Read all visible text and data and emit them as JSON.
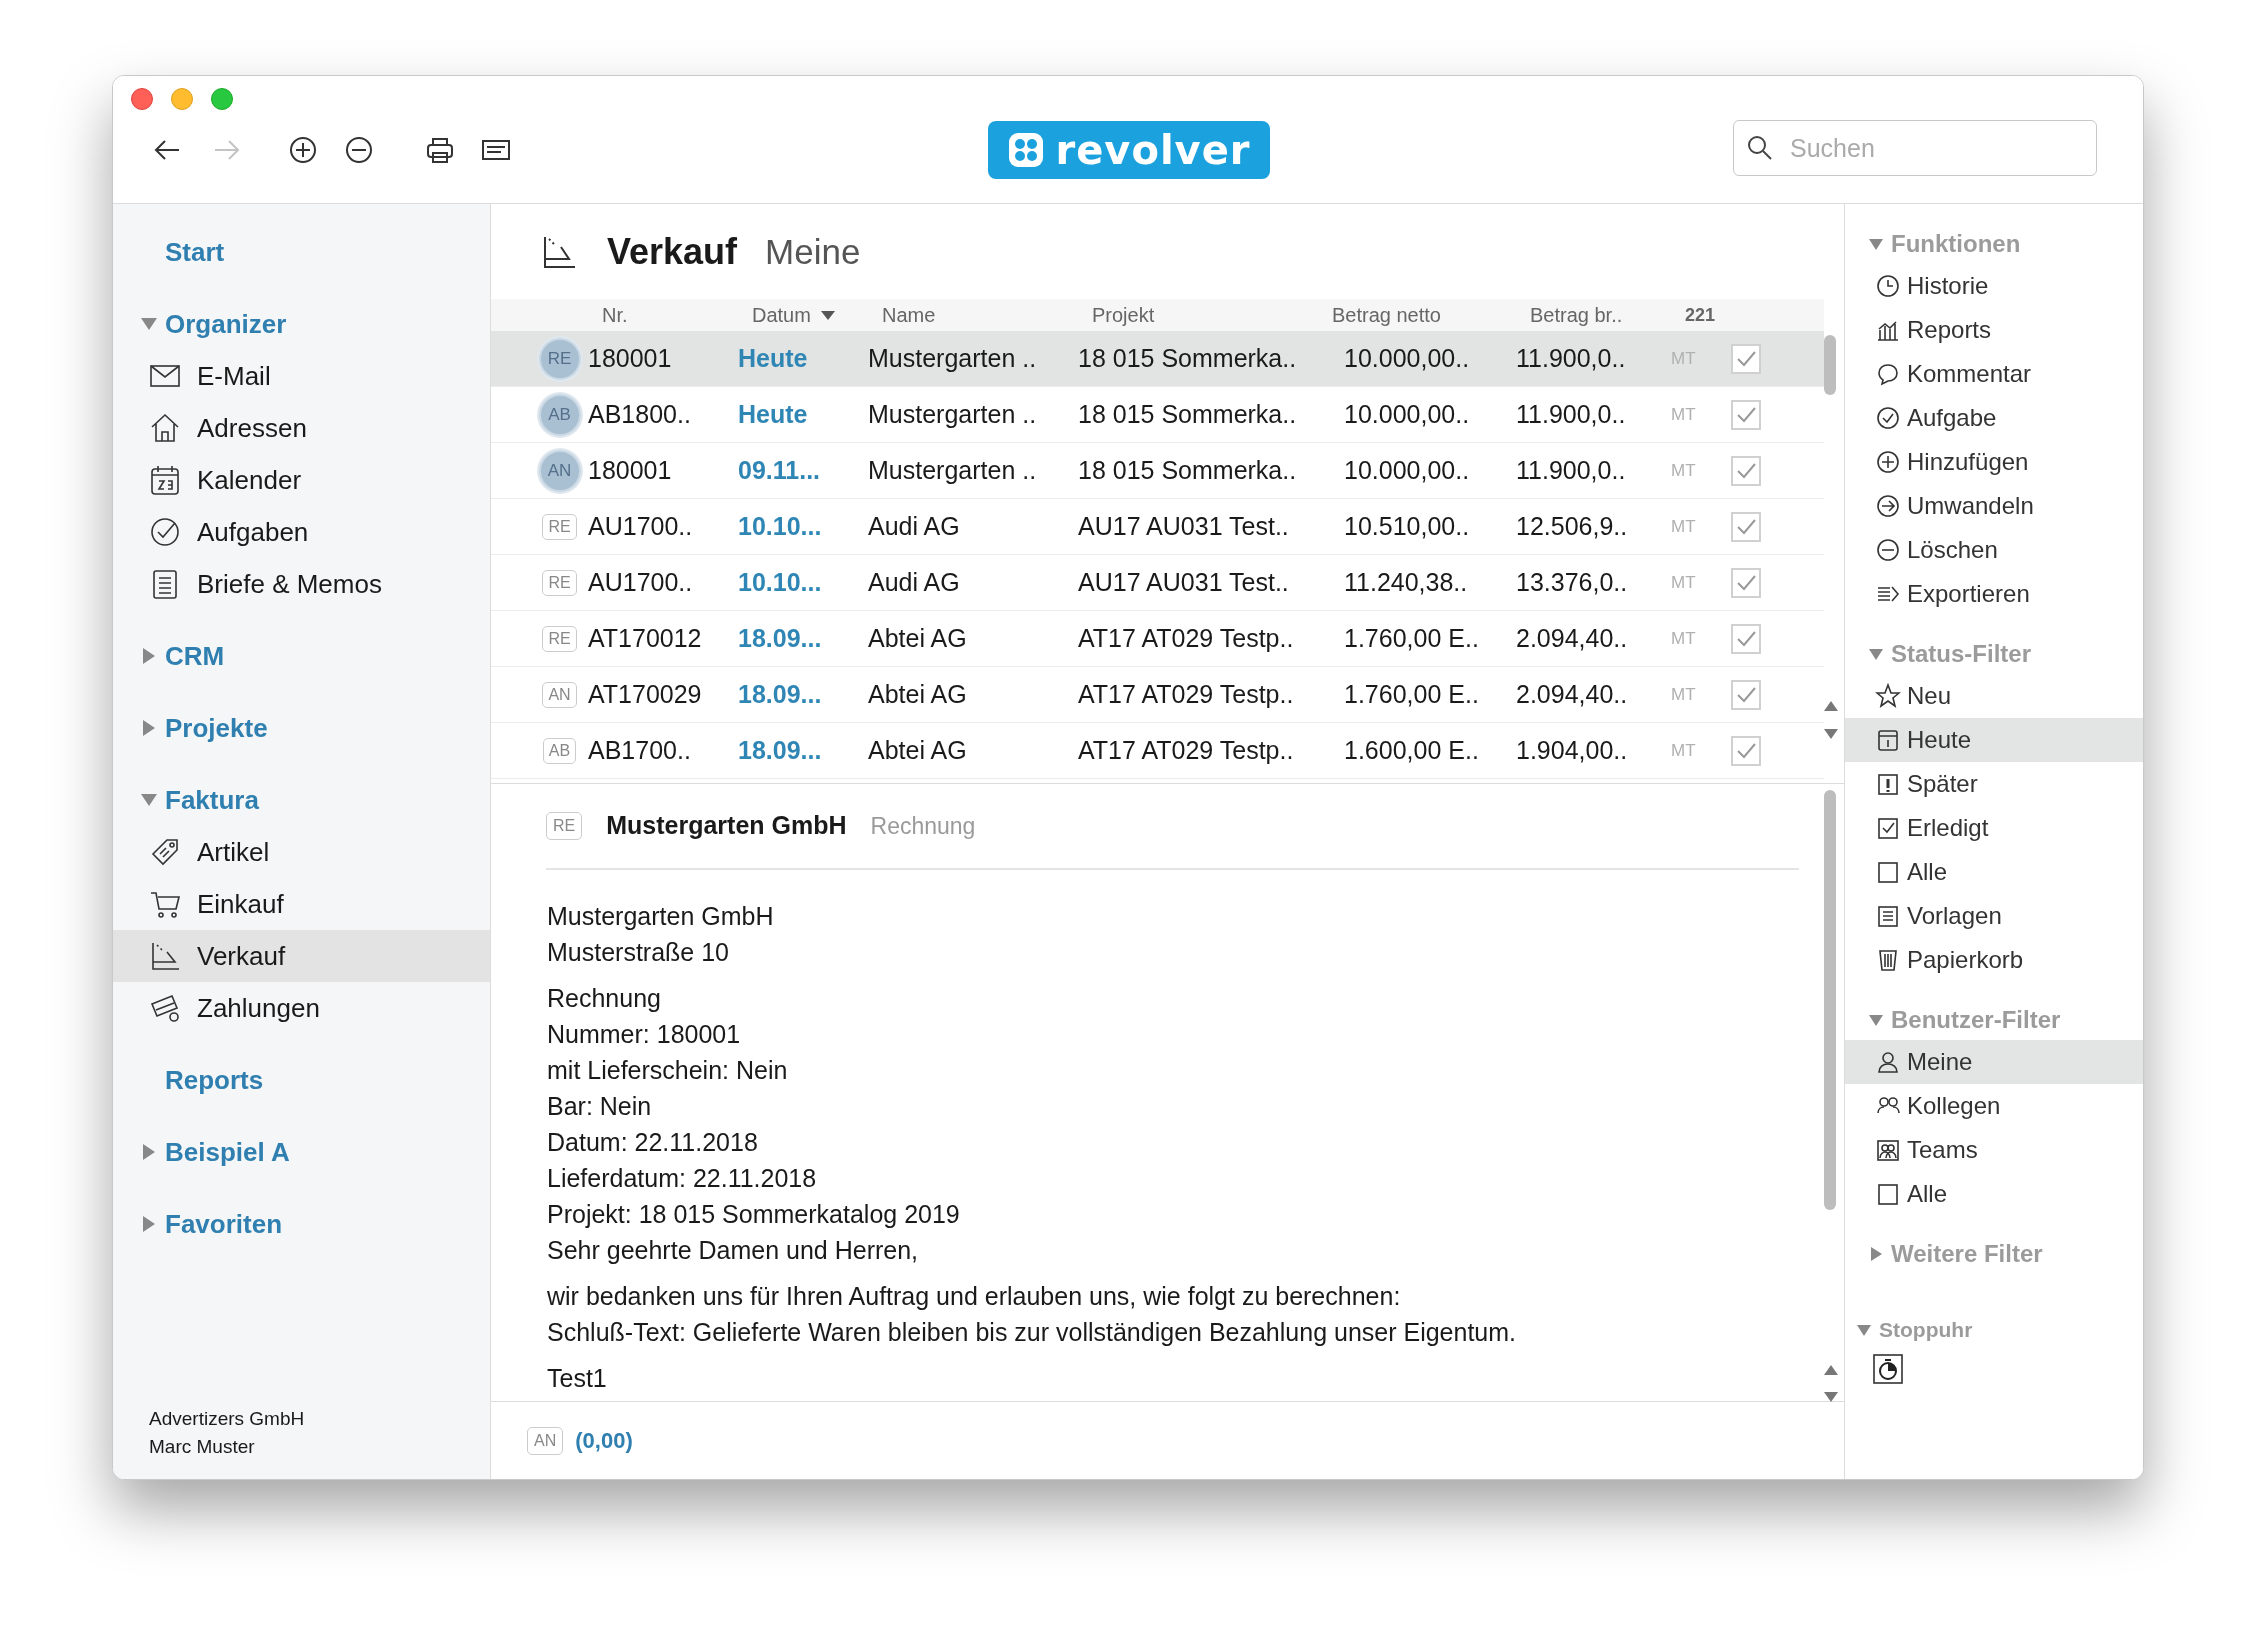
{
  "toolbar": {
    "buttons": [
      {
        "disabled": false
      },
      {
        "disabled": true
      },
      {
        "disabled": false
      },
      {
        "disabled": false
      },
      {
        "disabled": false
      },
      {
        "disabled": false
      }
    ],
    "logo": "revolver",
    "search": {
      "placeholder": "Suchen"
    }
  },
  "sidebar": {
    "sections": [
      {
        "kind": "link",
        "label": "Start"
      },
      {
        "kind": "group",
        "label": "Organizer",
        "expanded": true,
        "items": [
          {
            "label": "E-Mail",
            "selected": false
          },
          {
            "label": "Adressen",
            "selected": false
          },
          {
            "label": "Kalender",
            "selected": false
          },
          {
            "label": "Aufgaben",
            "selected": false
          },
          {
            "label": "Briefe & Memos",
            "selected": false
          }
        ]
      },
      {
        "kind": "group",
        "label": "CRM",
        "expanded": false
      },
      {
        "kind": "group",
        "label": "Projekte",
        "expanded": false
      },
      {
        "kind": "group",
        "label": "Faktura",
        "expanded": true,
        "items": [
          {
            "label": "Artikel",
            "selected": false
          },
          {
            "label": "Einkauf",
            "selected": false
          },
          {
            "label": "Verkauf",
            "selected": true
          },
          {
            "label": "Zahlungen",
            "selected": false
          }
        ]
      },
      {
        "kind": "link",
        "label": "Reports"
      },
      {
        "kind": "group",
        "label": "Beispiel A",
        "expanded": false
      },
      {
        "kind": "group",
        "label": "Favoriten",
        "expanded": false
      }
    ],
    "footer": [
      "Advertizers GmbH",
      "Marc Muster"
    ]
  },
  "main": {
    "title": "Verkauf",
    "subtitle": "Meine",
    "table": {
      "columns": [
        {
          "label": "Nr.",
          "sorted": false
        },
        {
          "label": "Datum",
          "sorted": true
        },
        {
          "label": "Name",
          "sorted": false
        },
        {
          "label": "Projekt",
          "sorted": false
        },
        {
          "label": "Betrag netto",
          "sorted": false
        },
        {
          "label": "Betrag br..",
          "sorted": false
        },
        {
          "label": "221",
          "sorted": false
        }
      ],
      "rows": [
        {
          "badge": "RE",
          "flagged": true,
          "nr": "180001",
          "datum": "Heute",
          "name": "Mustergarten ..",
          "projekt": "18 015 Sommerka..",
          "netto": "10.000,00..",
          "brutto": "11.900,0..",
          "currency": "MT",
          "checked": true,
          "selected": true
        },
        {
          "badge": "AB",
          "flagged": true,
          "nr": "AB1800..",
          "datum": "Heute",
          "name": "Mustergarten ..",
          "projekt": "18 015 Sommerka..",
          "netto": "10.000,00..",
          "brutto": "11.900,0..",
          "currency": "MT",
          "checked": true,
          "selected": false
        },
        {
          "badge": "AN",
          "flagged": true,
          "nr": "180001",
          "datum": "09.11...",
          "name": "Mustergarten ..",
          "projekt": "18 015 Sommerka..",
          "netto": "10.000,00..",
          "brutto": "11.900,0..",
          "currency": "MT",
          "checked": true,
          "selected": false
        },
        {
          "badge": "RE",
          "flagged": false,
          "nr": "AU1700..",
          "datum": "10.10...",
          "name": "Audi AG",
          "projekt": "AU17 AU031 Test..",
          "netto": "10.510,00..",
          "brutto": "12.506,9..",
          "currency": "MT",
          "checked": true,
          "selected": false
        },
        {
          "badge": "RE",
          "flagged": false,
          "nr": "AU1700..",
          "datum": "10.10...",
          "name": "Audi AG",
          "projekt": "AU17 AU031 Test..",
          "netto": "11.240,38..",
          "brutto": "13.376,0..",
          "currency": "MT",
          "checked": true,
          "selected": false
        },
        {
          "badge": "RE",
          "flagged": false,
          "nr": "AT170012",
          "datum": "18.09...",
          "name": "Abtei AG",
          "projekt": "AT17 AT029 Testp..",
          "netto": "1.760,00 E..",
          "brutto": "2.094,40..",
          "currency": "MT",
          "checked": true,
          "selected": false
        },
        {
          "badge": "AN",
          "flagged": false,
          "nr": "AT170029",
          "datum": "18.09...",
          "name": "Abtei AG",
          "projekt": "AT17 AT029 Testp..",
          "netto": "1.760,00 E..",
          "brutto": "2.094,40..",
          "currency": "MT",
          "checked": true,
          "selected": false
        },
        {
          "badge": "AB",
          "flagged": false,
          "nr": "AB1700..",
          "datum": "18.09...",
          "name": "Abtei AG",
          "projekt": "AT17 AT029 Testp..",
          "netto": "1.600,00 E..",
          "brutto": "1.904,00..",
          "currency": "MT",
          "checked": true,
          "selected": false
        }
      ]
    },
    "detail": {
      "badge": "RE",
      "title": "Mustergarten GmbH",
      "type": "Rechnung",
      "blocks": [
        [
          "Mustergarten GmbH",
          "Musterstraße 10"
        ],
        [
          "Rechnung",
          "Nummer: 180001",
          "mit Lieferschein: Nein",
          "Bar: Nein",
          "Datum: 22.11.2018",
          "Lieferdatum: 22.11.2018",
          "Projekt: 18 015 Sommerkatalog 2019",
          "Sehr geehrte Damen und Herren,"
        ],
        [
          "wir bedanken uns für Ihren Auftrag und erlauben uns, wie folgt zu berechnen:",
          "Schluß-Text: Gelieferte Waren bleiben bis zur vollständigen Bezahlung unser Eigentum."
        ],
        [
          "Test1"
        ]
      ]
    },
    "footer": {
      "badge": "AN",
      "amount": "(0,00)"
    }
  },
  "inspector": {
    "sections": [
      {
        "label": "Funktionen",
        "expanded": true,
        "items": [
          {
            "label": "Historie",
            "selected": false
          },
          {
            "label": "Reports",
            "selected": false
          },
          {
            "label": "Kommentar",
            "selected": false
          },
          {
            "label": "Aufgabe",
            "selected": false
          },
          {
            "label": "Hinzufügen",
            "selected": false
          },
          {
            "label": "Umwandeln",
            "selected": false
          },
          {
            "label": "Löschen",
            "selected": false
          },
          {
            "label": "Exportieren",
            "selected": false
          }
        ]
      },
      {
        "label": "Status-Filter",
        "expanded": true,
        "items": [
          {
            "label": "Neu",
            "selected": false
          },
          {
            "label": "Heute",
            "selected": true
          },
          {
            "label": "Später",
            "selected": false
          },
          {
            "label": "Erledigt",
            "selected": false
          },
          {
            "label": "Alle",
            "selected": false
          },
          {
            "label": "Vorlagen",
            "selected": false
          },
          {
            "label": "Papierkorb",
            "selected": false
          }
        ]
      },
      {
        "label": "Benutzer-Filter",
        "expanded": true,
        "items": [
          {
            "label": "Meine",
            "selected": true
          },
          {
            "label": "Kollegen",
            "selected": false
          },
          {
            "label": "Teams",
            "selected": false
          },
          {
            "label": "Alle",
            "selected": false
          }
        ]
      },
      {
        "label": "Weitere Filter",
        "expanded": false
      }
    ],
    "stopwatch": {
      "label": "Stoppuhr",
      "expanded": true
    }
  }
}
